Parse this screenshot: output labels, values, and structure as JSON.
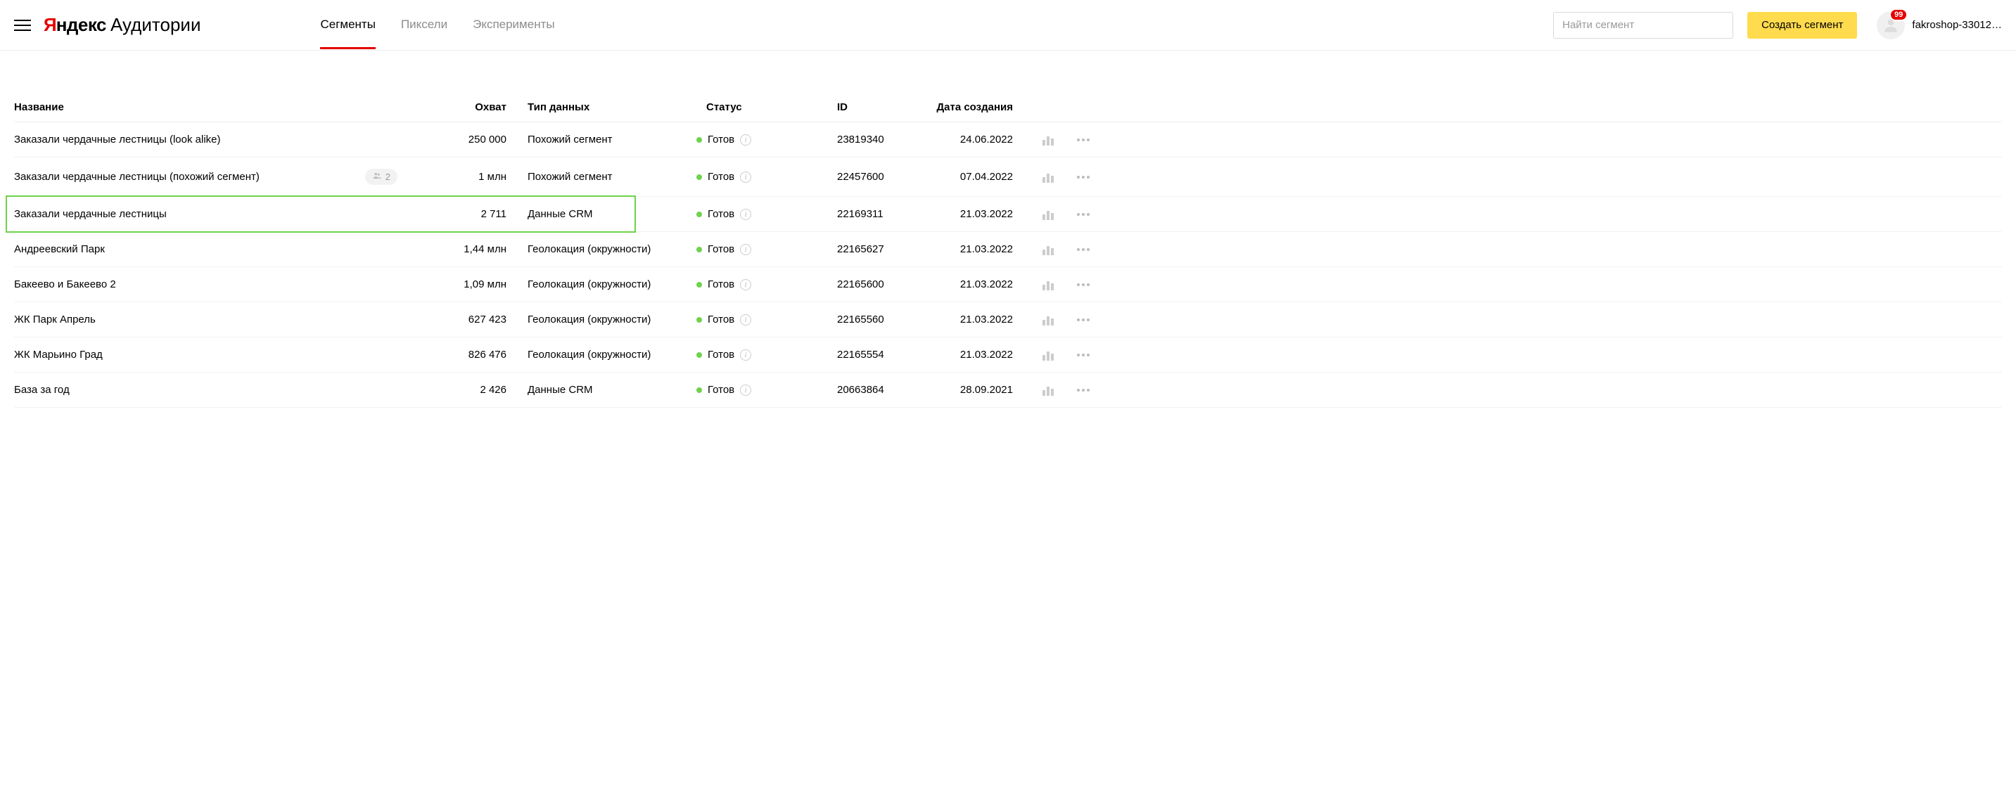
{
  "header": {
    "logo_yandex_y": "Я",
    "logo_yandex": "ндекс",
    "logo_product": "Аудитории",
    "tabs": [
      {
        "label": "Сегменты",
        "active": true
      },
      {
        "label": "Пиксели",
        "active": false
      },
      {
        "label": "Эксперименты",
        "active": false
      }
    ],
    "search_placeholder": "Найти сегмент",
    "create_label": "Создать сегмент",
    "notif_count": "99",
    "username": "fakroshop-33012…"
  },
  "table": {
    "columns": {
      "name": "Название",
      "reach": "Охват",
      "type": "Тип данных",
      "status": "Статус",
      "id": "ID",
      "date": "Дата создания"
    },
    "status_ready": "Готов",
    "rows": [
      {
        "name": "Заказали чердачные лестницы (look alike)",
        "share": null,
        "reach": "250 000",
        "type": "Похожий сегмент",
        "status": "Готов",
        "id": "23819340",
        "date": "24.06.2022",
        "highlight": false
      },
      {
        "name": "Заказали чердачные лестницы (похожий сегмент)",
        "share": "2",
        "reach": "1 млн",
        "type": "Похожий сегмент",
        "status": "Готов",
        "id": "22457600",
        "date": "07.04.2022",
        "highlight": false
      },
      {
        "name": "Заказали чердачные лестницы",
        "share": null,
        "reach": "2 711",
        "type": "Данные CRM",
        "status": "Готов",
        "id": "22169311",
        "date": "21.03.2022",
        "highlight": true
      },
      {
        "name": "Андреевский Парк",
        "share": null,
        "reach": "1,44 млн",
        "type": "Геолокация (окружности)",
        "status": "Готов",
        "id": "22165627",
        "date": "21.03.2022",
        "highlight": false
      },
      {
        "name": "Бакеево и Бакеево 2",
        "share": null,
        "reach": "1,09 млн",
        "type": "Геолокация (окружности)",
        "status": "Готов",
        "id": "22165600",
        "date": "21.03.2022",
        "highlight": false
      },
      {
        "name": "ЖК Парк Апрель",
        "share": null,
        "reach": "627 423",
        "type": "Геолокация (окружности)",
        "status": "Готов",
        "id": "22165560",
        "date": "21.03.2022",
        "highlight": false
      },
      {
        "name": "ЖК Марьино Град",
        "share": null,
        "reach": "826 476",
        "type": "Геолокация (окружности)",
        "status": "Готов",
        "id": "22165554",
        "date": "21.03.2022",
        "highlight": false
      },
      {
        "name": "База за год",
        "share": null,
        "reach": "2 426",
        "type": "Данные CRM",
        "status": "Готов",
        "id": "20663864",
        "date": "28.09.2021",
        "highlight": false
      }
    ]
  }
}
